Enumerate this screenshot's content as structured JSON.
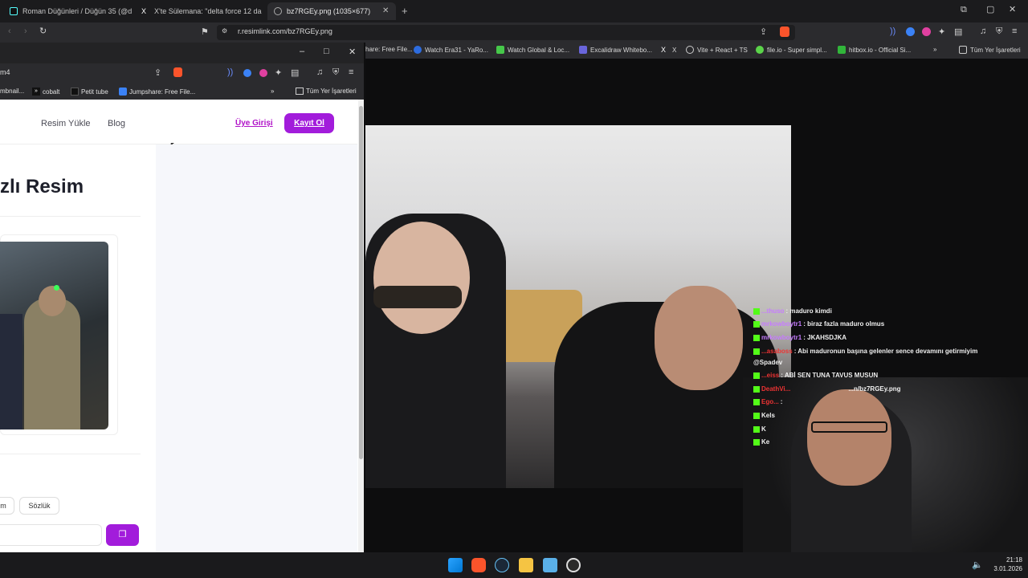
{
  "outer_browser": {
    "tabs": [
      {
        "label": "Roman Düğünleri / Düğün 35 (@dug",
        "icon": "tiktok-icon"
      },
      {
        "label": "X'te Sülemana: \"delta force 12 dakika",
        "icon": "x-icon"
      },
      {
        "label": "bz7RGEy.png (1035×677)",
        "icon": "globe-icon",
        "active": true
      }
    ],
    "new_tab_label": "+",
    "url": "r.resimlink.com/bz7RGEy.png",
    "bookmarks": [
      "hare: Free File...",
      "Watch Era31 - YaRo...",
      "Watch Global & Loc...",
      "Excalidraw Whitebo...",
      "X",
      "Vite + React + TS",
      "file.io - Super simpl...",
      "hitbox.io - Official Si..."
    ],
    "bookmarks_folder": "Tüm Yer İşaretleri",
    "overflow": "»"
  },
  "inner_browser": {
    "url_fragment": "m4",
    "bookmarks": [
      "mbnail...",
      "cobalt",
      "Petit tube",
      "Jumpshare: Free File..."
    ],
    "bookmarks_folder": "Tüm Yer İşaretleri",
    "overflow": "»",
    "window_controls": {
      "minimize": "–",
      "maximize": "□",
      "close": "✕"
    }
  },
  "site": {
    "nav": {
      "upload": "Resim Yükle",
      "blog": "Blog"
    },
    "login": "Üye Girişi",
    "signup": "Kayıt Ol",
    "heading": "zlı Resim",
    "pills": [
      "m",
      "Sözlük"
    ],
    "copy_button_icon": "copy-icon"
  },
  "chat": [
    {
      "user": "...thuso",
      "msg": ": maduro kimdi"
    },
    {
      "user": "mrkowboytr1",
      "msg": ": biraz fazla maduro olmus"
    },
    {
      "user": "mrkowboytr1",
      "msg": ": JKAHSDJKA"
    },
    {
      "user": "...asaboss",
      "msg": ": Abi maduronun başına gelenler sence devamını getirmiyim"
    },
    {
      "user": "",
      "msg": "@Spadev"
    },
    {
      "user": "...eiss",
      "msg": ": ABİ SEN TUNA TAVUS MUSUN"
    },
    {
      "user": "DeathVi...",
      "msg": "...n/bz7RGEy.png"
    },
    {
      "user": "Ego...",
      "msg": ":"
    },
    {
      "user": "Kels",
      "msg": ""
    },
    {
      "user": "K",
      "msg": ""
    },
    {
      "user": "Ke",
      "msg": ""
    }
  ],
  "taskbar": {
    "apps": [
      "windows-start-icon",
      "brave-icon",
      "steam-icon",
      "folder-icon",
      "store-icon",
      "obs-icon"
    ],
    "time": "21:18",
    "date": "3.01.2026"
  },
  "colors": {
    "accent": "#a21cdb",
    "kick_green": "#53fc18"
  }
}
